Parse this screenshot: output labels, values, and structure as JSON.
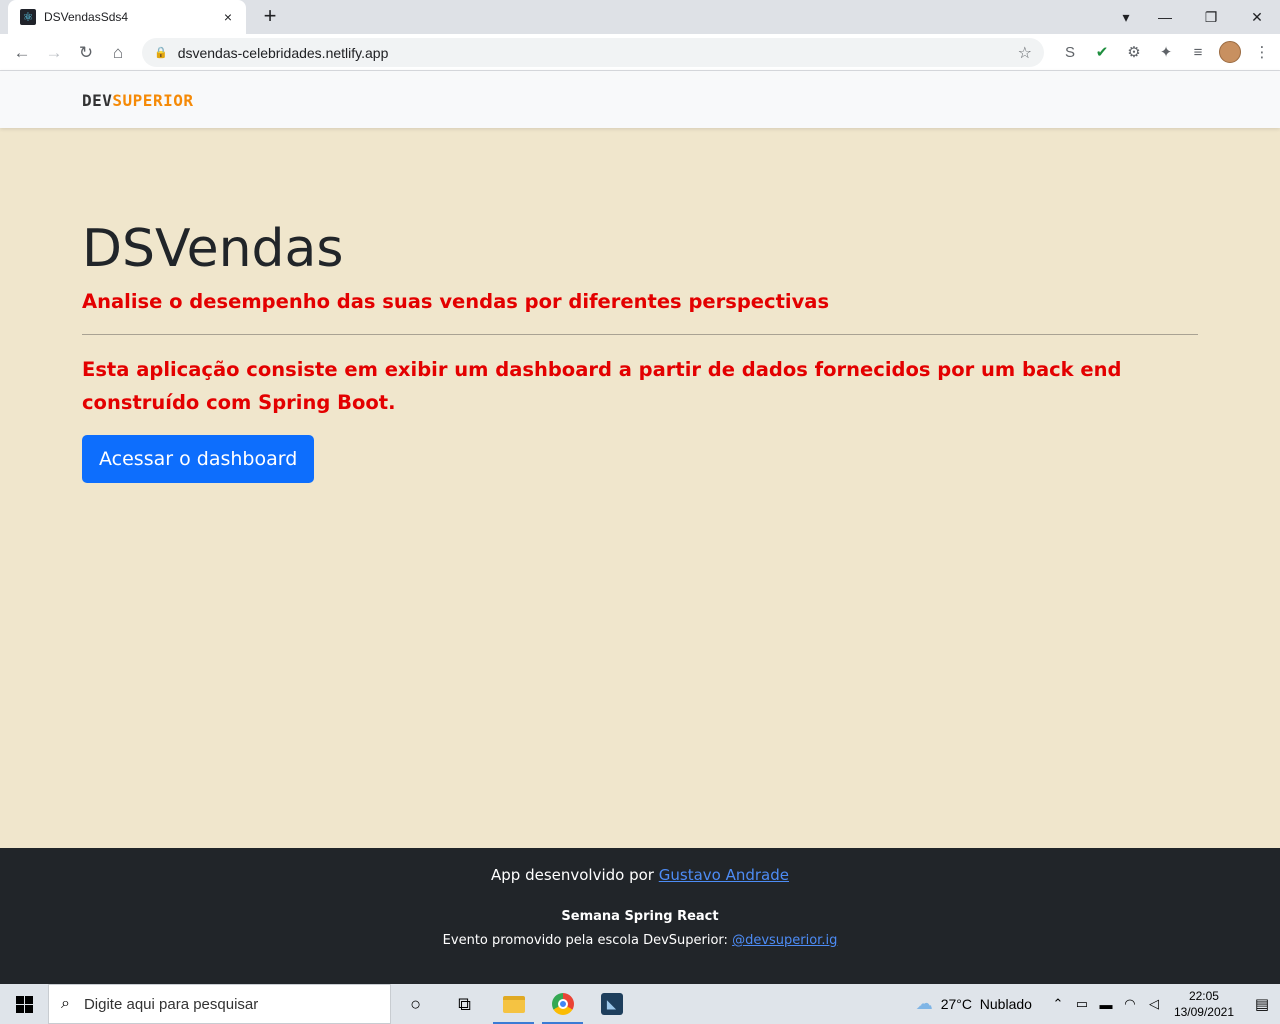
{
  "browser": {
    "tab_title": "DSVendasSds4",
    "tab_close": "×",
    "new_tab": "+",
    "url": "dsvendas-celebridades.netlify.app",
    "icons": {
      "back": "←",
      "forward": "→",
      "reload": "↻",
      "home": "⌂",
      "lock": "🔒",
      "star": "☆",
      "minimize": "—",
      "restore": "❐",
      "close": "✕",
      "tab_search": "▾",
      "extensions": [
        "S",
        "✔",
        "⚙",
        "✦",
        "≡",
        "⋮"
      ]
    }
  },
  "site": {
    "brand_dev": "DEV",
    "brand_superior": "SUPERIOR",
    "title": "DSVendas",
    "subtitle": "Analise o desempenho das suas vendas por diferentes perspectivas",
    "description": "Esta aplicação consiste em exibir um dashboard a partir de dados fornecidos por um back end construído com Spring Boot.",
    "cta_label": "Acessar o dashboard"
  },
  "footer": {
    "line1_prefix": "App desenvolvido por ",
    "author_link": "Gustavo Andrade",
    "line2": "Semana Spring React",
    "line3_prefix": "Evento promovido pela escola DevSuperior: ",
    "ig_link": "@devsuperior.ig"
  },
  "taskbar": {
    "search_placeholder": "Digite aqui para pesquisar",
    "weather_temp": "27°C",
    "weather_desc": "Nublado",
    "time": "22:05",
    "date": "13/09/2021"
  },
  "colors": {
    "page_bg": "#f0e6cc",
    "accent_red": "#e30000",
    "brand_orange": "#f58a07",
    "button_blue": "#0d6efd",
    "footer_bg": "#212529"
  }
}
